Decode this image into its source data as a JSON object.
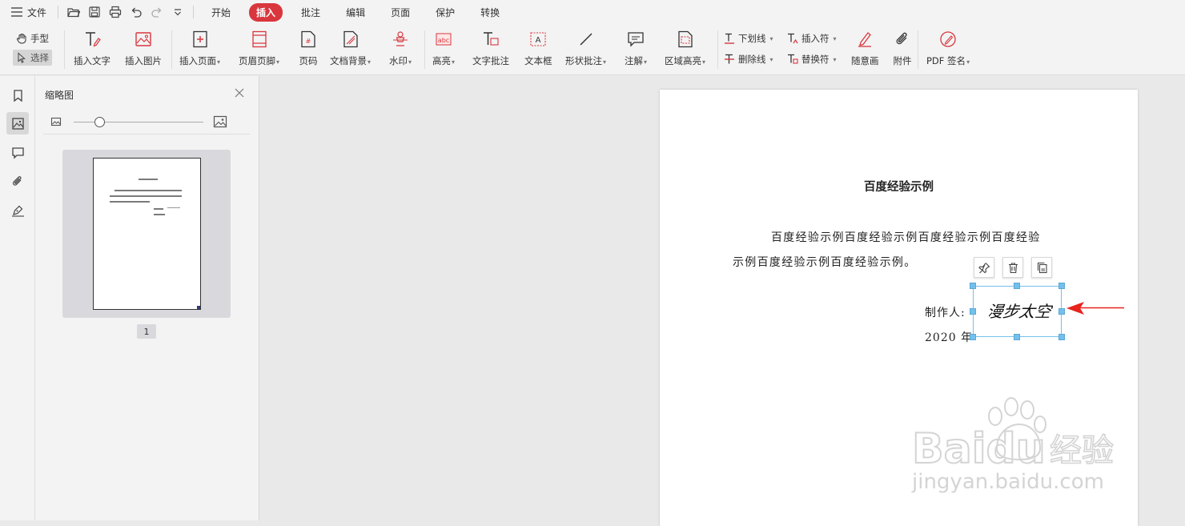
{
  "menubar": {
    "file_label": "文件",
    "tabs": [
      {
        "label": "开始",
        "active": false
      },
      {
        "label": "插入",
        "active": true
      },
      {
        "label": "批注",
        "active": false
      },
      {
        "label": "编辑",
        "active": false
      },
      {
        "label": "页面",
        "active": false
      },
      {
        "label": "保护",
        "active": false
      },
      {
        "label": "转换",
        "active": false
      }
    ],
    "accent_color": "#d9363e"
  },
  "ribbon": {
    "hand_label": "手型",
    "select_label": "选择",
    "insert_text": "插入文字",
    "insert_image": "插入图片",
    "insert_page": "插入页面",
    "header_footer": "页眉页脚",
    "page_number": "页码",
    "doc_background": "文档背景",
    "watermark": "水印",
    "highlight": "高亮",
    "text_comment": "文字批注",
    "text_box": "文本框",
    "shape_comment": "形状批注",
    "annotation": "注解",
    "area_highlight": "区域高亮",
    "underline": "下划线",
    "strikethrough": "删除线",
    "insert_mark": "插入符",
    "replace_mark": "替换符",
    "freehand": "随意画",
    "attachment": "附件",
    "pdf_sign": "PDF 签名"
  },
  "thumbpanel": {
    "title": "缩略图",
    "page_number": "1",
    "zoom_fraction": 0.2
  },
  "document": {
    "title": "百度经验示例",
    "para_line1": "百度经验示例百度经验示例百度经验示例百度经验",
    "para_line2": "示例百度经验示例百度经验示例。",
    "maker_label": "制作人:",
    "date_text": "2020 年",
    "signature_text": "漫步太空"
  },
  "watermark": {
    "brand": "Baidu",
    "brand_cn": "经验",
    "url": "jingyan.baidu.com"
  },
  "colors": {
    "selection": "#74c0ec",
    "arrow": "#e8231e"
  }
}
